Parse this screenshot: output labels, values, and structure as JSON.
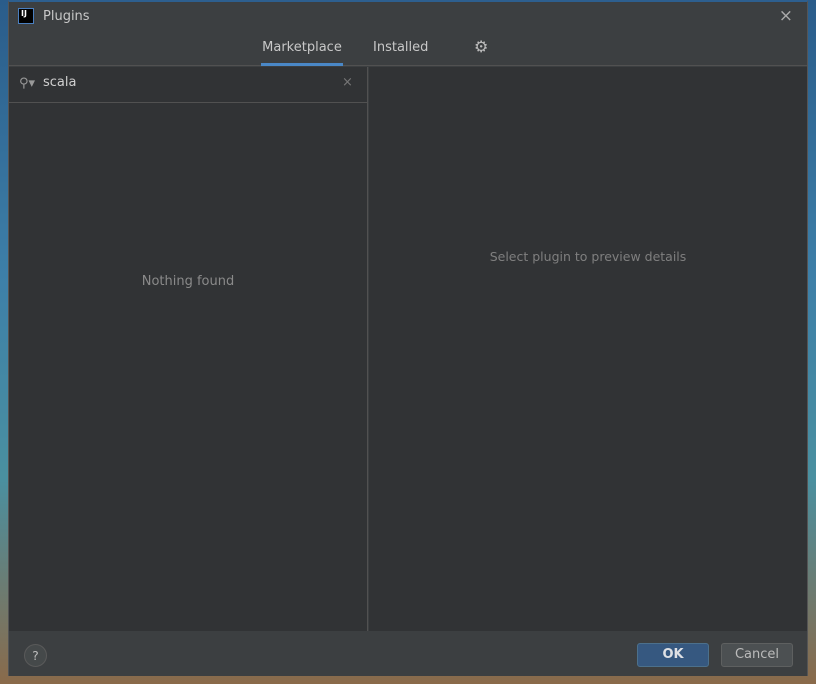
{
  "window": {
    "title": "Plugins",
    "app_icon_text": "IJ"
  },
  "tabs": [
    {
      "label": "Marketplace",
      "active": true
    },
    {
      "label": "Installed",
      "active": false
    }
  ],
  "search": {
    "value": "scala",
    "placeholder": ""
  },
  "results": {
    "empty_text": "Nothing found"
  },
  "details": {
    "empty_text": "Select plugin to preview details"
  },
  "footer": {
    "help": "?",
    "ok": "OK",
    "cancel": "Cancel"
  },
  "icons": {
    "close": "×",
    "gear": "⚙",
    "search": "🔍",
    "clear": "×"
  },
  "colors": {
    "accent": "#4a88c7",
    "ok_button": "#365880",
    "panel": "#313335",
    "chrome": "#3c3f41"
  }
}
